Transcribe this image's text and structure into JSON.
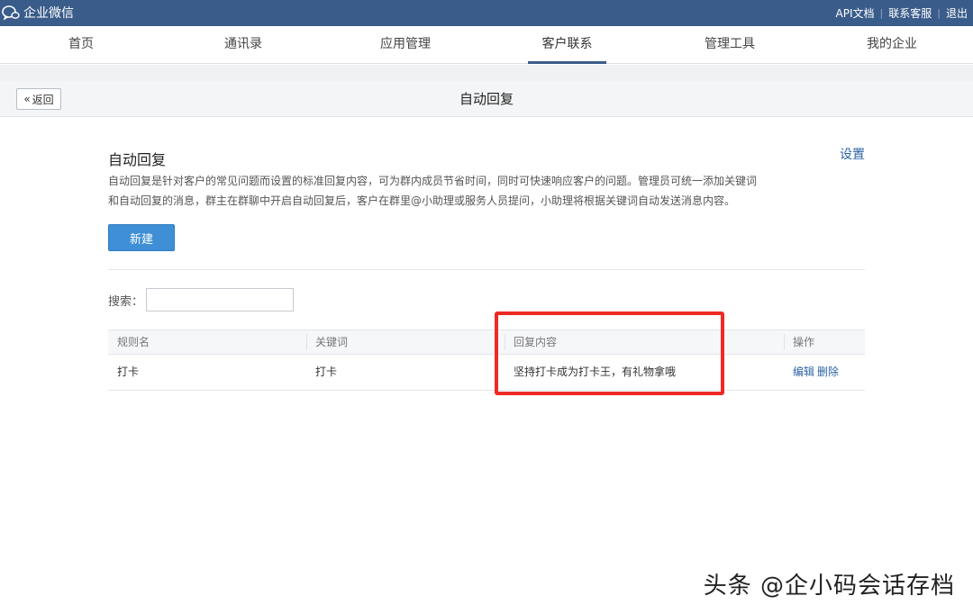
{
  "topbar": {
    "logo": "企业微信",
    "links": [
      "API文档",
      "联系客服",
      "退出"
    ]
  },
  "nav": {
    "items": [
      "首页",
      "通讯录",
      "应用管理",
      "客户联系",
      "管理工具",
      "我的企业"
    ],
    "active": "客户联系"
  },
  "subheader": {
    "back_label": "返回",
    "title": "自动回复"
  },
  "section": {
    "title": "自动回复",
    "settings": "设置",
    "desc_line1": "自动回复是针对客户的常见问题而设置的标准回复内容，可为群内成员节省时间，同时可快速响应客户的问题。管理员可统一添加关键词",
    "desc_line2": "和自动回复的消息，群主在群聊中开启自动回复后，客户在群里@小助理或服务人员提问，小助理将根据关键词自动发送消息内容。",
    "new_button": "新建"
  },
  "search": {
    "label": "搜索：",
    "value": ""
  },
  "table": {
    "headers": [
      "规则名",
      "关键词",
      "回复内容",
      "操作"
    ],
    "rows": [
      {
        "name": "打卡",
        "keyword": "打卡",
        "reply": "坚持打卡成为打卡王，有礼物拿哦",
        "ops": [
          "编辑",
          "删除"
        ]
      }
    ]
  },
  "watermark": "头条 @企小码会话存档",
  "colors": {
    "topbar": "#3a5c8a",
    "primary_button": "#3f8fd6",
    "link": "#2b63a6",
    "highlight_box": "#ee2a24"
  }
}
